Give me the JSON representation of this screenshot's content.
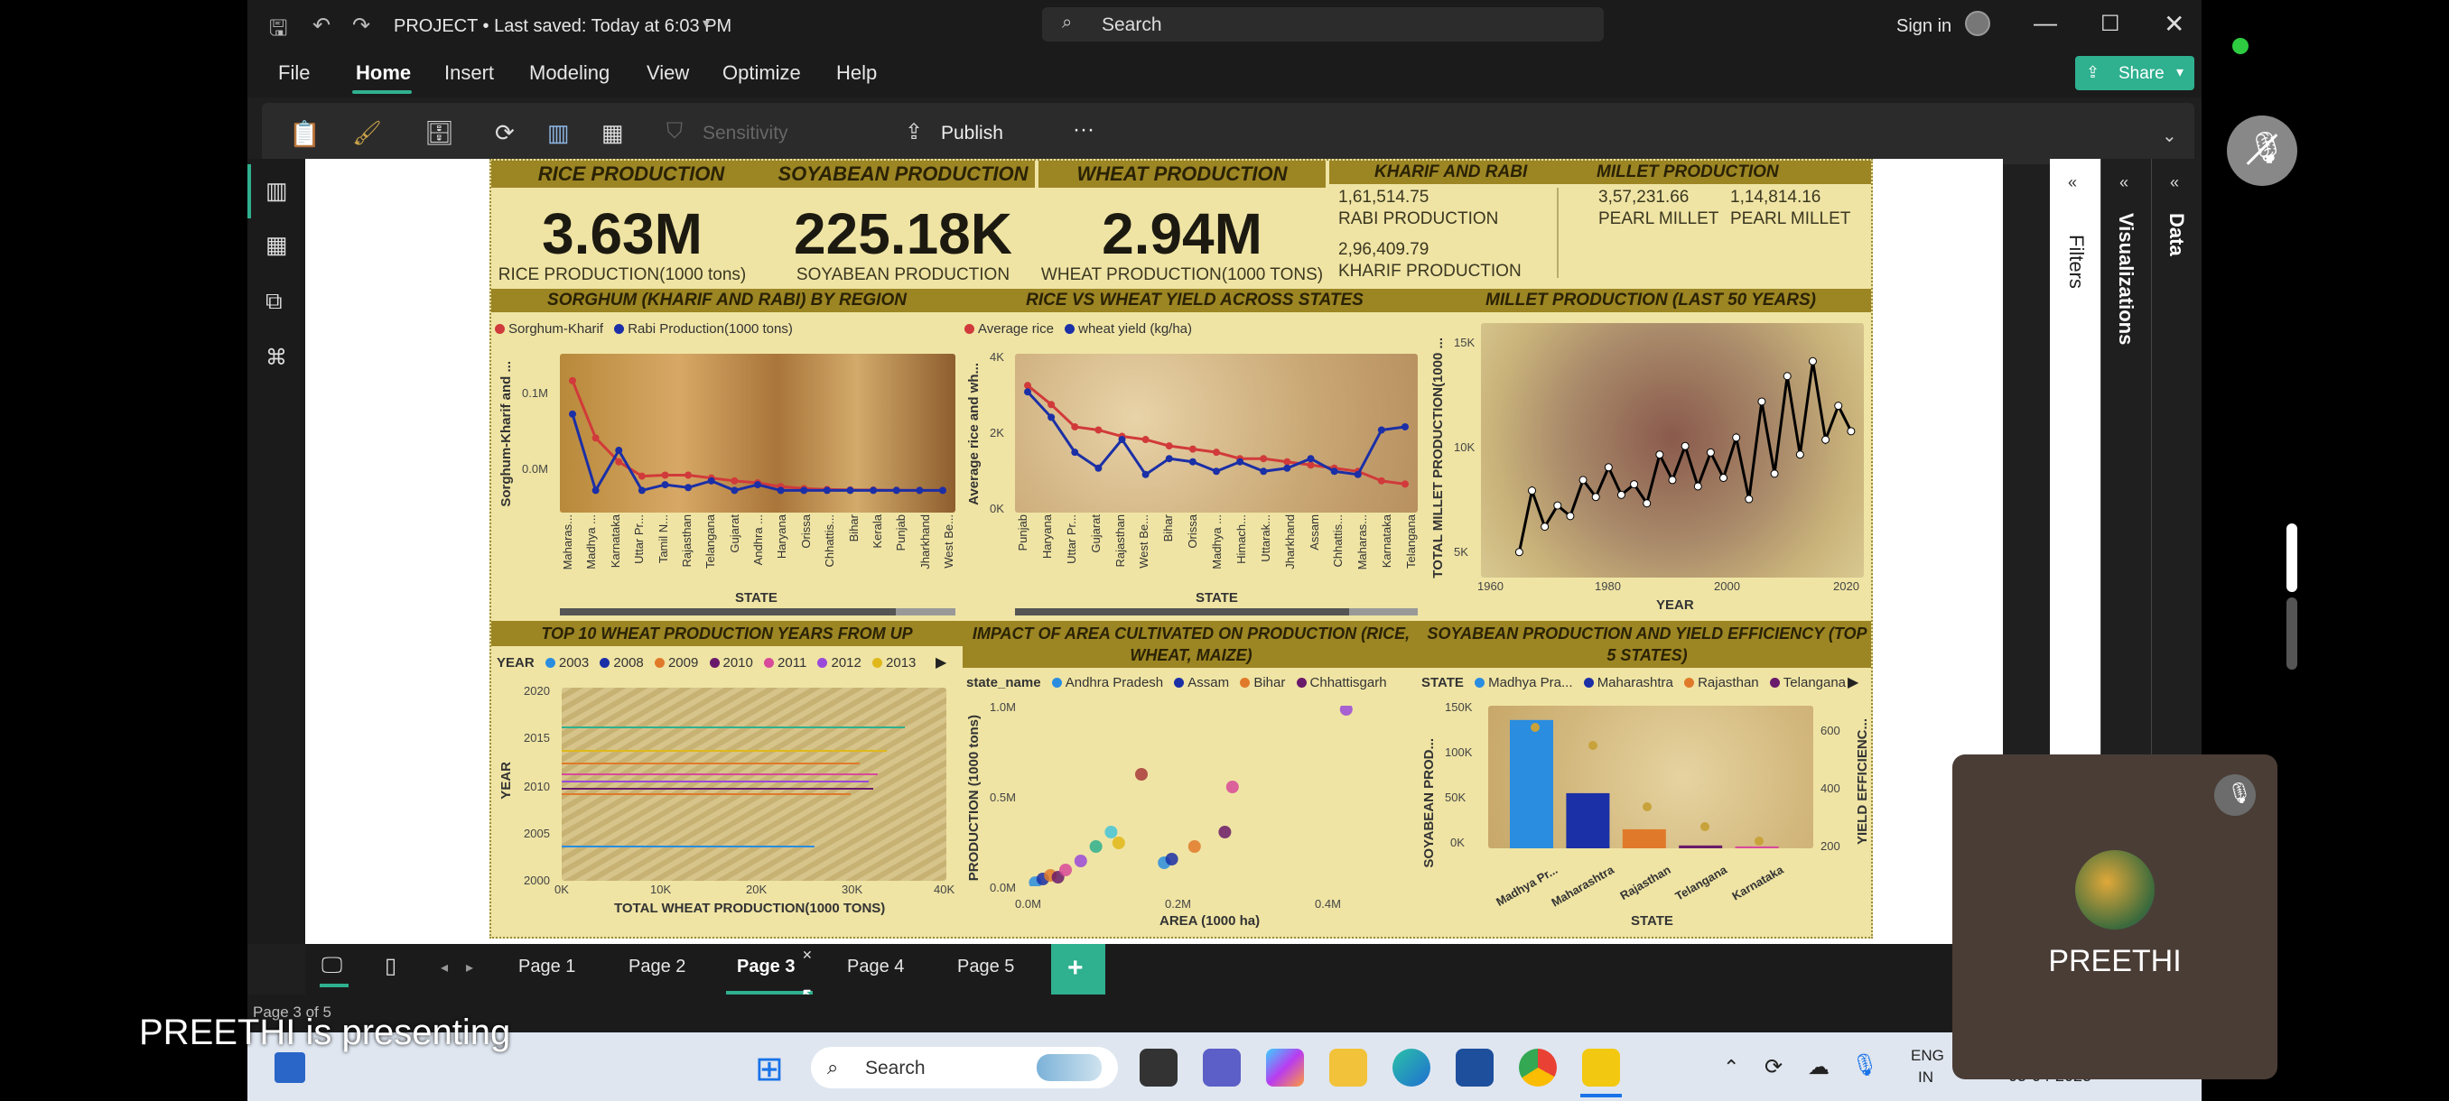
{
  "titlebar": {
    "project_title": "PROJECT • Last saved: Today at 6:03 PM",
    "search_placeholder": "Search",
    "sign_in": "Sign in"
  },
  "menu": {
    "items": [
      "File",
      "Home",
      "Insert",
      "Modeling",
      "View",
      "Optimize",
      "Help"
    ],
    "active": "Home",
    "share": "Share"
  },
  "ribbon": {
    "sensitivity": "Sensitivity",
    "publish": "Publish",
    "more": "···"
  },
  "panes": {
    "filters": "Filters",
    "visualizations": "Visualizations",
    "data": "Data"
  },
  "report": {
    "headers": {
      "rice": "RICE PRODUCTION",
      "soy": "SOYABEAN PRODUCTION",
      "wheat": "WHEAT PRODUCTION",
      "kharif_rabi": "KHARIF AND RABI",
      "millet": "MILLET PRODUCTION"
    },
    "kpis": {
      "rice_value": "3.63M",
      "rice_label": "RICE PRODUCTION(1000 tons)",
      "soy_value": "225.18K",
      "soy_label": "SOYABEAN PRODUCTION",
      "wheat_value": "2.94M",
      "wheat_label": "WHEAT PRODUCTION(1000 TONS)"
    },
    "kharif_rabi": {
      "rabi_value": "1,61,514.75",
      "rabi_label": "RABI PRODUCTION",
      "kharif_value": "2,96,409.79",
      "kharif_label": "KHARIF PRODUCTION"
    },
    "millet": {
      "v1": "3,57,231.66",
      "l1": "PEARL MILLET",
      "v2": "1,14,814.16",
      "l2": "PEARL MILLET"
    },
    "sorghum": {
      "title": "SORGHUM (KHARIF AND RABI) BY REGION",
      "legend": [
        "Sorghum-Kharif",
        "Rabi Production(1000 tons)"
      ],
      "ylabel": "Sorghum-Kharif and ...",
      "xlabel": "STATE",
      "yticks": [
        "0.1M",
        "0.0M"
      ],
      "states": [
        "Maharas...",
        "Madhya ...",
        "Karnataka",
        "Uttar Pr...",
        "Tamil N...",
        "Rajasthan",
        "Telangana",
        "Gujarat",
        "Andhra ...",
        "Haryana",
        "Orissa",
        "Chhattis...",
        "Bihar",
        "Kerala",
        "Punjab",
        "Jharkhand",
        "West Be..."
      ]
    },
    "ricewheat": {
      "title": "RICE VS WHEAT YIELD ACROSS STATES",
      "legend": [
        "Average rice",
        "wheat yield (kg/ha)"
      ],
      "ylabel": "Average rice and wh...",
      "xlabel": "STATE",
      "yticks": [
        "4K",
        "2K",
        "0K"
      ],
      "states": [
        "Punjab",
        "Haryana",
        "Uttar Pr...",
        "Gujarat",
        "Rajasthan",
        "West Be...",
        "Bihar",
        "Orissa",
        "Madhya ...",
        "Himach...",
        "Uttarak...",
        "Jharkhand",
        "Assam",
        "Chhattis...",
        "Maharas...",
        "Karnataka",
        "Telangana"
      ]
    },
    "millet_chart": {
      "title": "MILLET PRODUCTION (LAST 50 YEARS)",
      "ylabel": "TOTAL MILLET PRODUCTION(1000 ...",
      "xlabel": "YEAR",
      "yticks": [
        "15K",
        "10K",
        "5K"
      ],
      "xticks": [
        "1960",
        "1980",
        "2000",
        "2020"
      ]
    },
    "wheat_top": {
      "title": "TOP 10 WHEAT PRODUCTION YEARS FROM UP",
      "legend_title": "YEAR",
      "legend": [
        "2003",
        "2008",
        "2009",
        "2010",
        "2011",
        "2012",
        "2013"
      ],
      "ylabel": "YEAR",
      "xlabel": "TOTAL WHEAT PRODUCTION(1000 TONS)",
      "yticks": [
        "2020",
        "2015",
        "2010",
        "2005",
        "2000"
      ],
      "xticks": [
        "0K",
        "10K",
        "20K",
        "30K",
        "40K"
      ]
    },
    "impact": {
      "title": "IMPACT OF AREA CULTIVATED ON PRODUCTION (RICE, WHEAT, MAIZE)",
      "legend_title": "state_name",
      "legend": [
        "Andhra Pradesh",
        "Assam",
        "Bihar",
        "Chhattisgarh"
      ],
      "ylabel": "PRODUCTION (1000 tons)",
      "xlabel": "AREA (1000 ha)",
      "yticks": [
        "1.0M",
        "0.5M",
        "0.0M"
      ],
      "xticks": [
        "0.0M",
        "0.2M",
        "0.4M"
      ]
    },
    "soy_chart": {
      "title": "SOYABEAN PRODUCTION AND YIELD EFFICIENCY (TOP 5 STATES)",
      "legend_title": "STATE",
      "legend": [
        "Madhya Pra...",
        "Maharashtra",
        "Rajasthan",
        "Telangana"
      ],
      "ylabel": "SOYABEAN PROD...",
      "y2label": "YIELD EFFICIENC...",
      "xlabel": "STATE",
      "yticks": [
        "150K",
        "100K",
        "50K",
        "0K"
      ],
      "y2ticks": [
        "600",
        "400",
        "200"
      ],
      "states": [
        "Madhya Pr...",
        "Maharashtra",
        "Rajasthan",
        "Telangana",
        "Karnataka"
      ]
    }
  },
  "chart_data": [
    {
      "type": "line",
      "title": "SORGHUM (KHARIF AND RABI) BY REGION",
      "xlabel": "STATE",
      "ylabel": "Sorghum-Kharif and ...",
      "categories": [
        "Maharas...",
        "Madhya ...",
        "Karnataka",
        "Uttar Pr...",
        "Tamil N...",
        "Rajasthan",
        "Telangana",
        "Gujarat",
        "Andhra ...",
        "Haryana",
        "Orissa",
        "Chhattis...",
        "Bihar",
        "Kerala",
        "Punjab",
        "Jharkhand",
        "West Be..."
      ],
      "series": [
        {
          "name": "Sorghum-Kharif",
          "values": [
            0.115,
            0.055,
            0.03,
            0.015,
            0.016,
            0.016,
            0.013,
            0.01,
            0.008,
            0.004,
            0.002,
            0.001,
            0.0005,
            0.0004,
            0.0002,
            0.0001,
            0.0001
          ]
        },
        {
          "name": "Rabi Production(1000 tons)",
          "values": [
            0.08,
            0.0,
            0.042,
            0.0,
            0.006,
            0.003,
            0.01,
            0.0,
            0.006,
            0.0,
            0.0,
            0.0,
            0.0,
            0.0,
            0.0,
            0.0,
            0.0
          ]
        }
      ]
    },
    {
      "type": "line",
      "title": "RICE VS WHEAT YIELD ACROSS STATES",
      "xlabel": "STATE",
      "ylabel": "Average rice and wh...",
      "categories": [
        "Punjab",
        "Haryana",
        "Uttar Pr...",
        "Gujarat",
        "Rajasthan",
        "West Be...",
        "Bihar",
        "Orissa",
        "Madhya ...",
        "Himach...",
        "Uttarak...",
        "Jharkhand",
        "Assam",
        "Chhattis...",
        "Maharas...",
        "Karnataka",
        "Telangana"
      ],
      "series": [
        {
          "name": "Average rice",
          "values": [
            3.6,
            3.0,
            2.3,
            2.2,
            2.0,
            1.9,
            1.7,
            1.6,
            1.5,
            1.3,
            1.3,
            1.2,
            1.1,
            1.0,
            0.9,
            0.6,
            0.5
          ]
        },
        {
          "name": "wheat yield (kg/ha)",
          "values": [
            3.4,
            2.6,
            1.5,
            1.0,
            1.9,
            0.8,
            1.3,
            1.2,
            0.9,
            1.2,
            0.9,
            1.0,
            1.3,
            0.9,
            0.8,
            2.2,
            2.3
          ]
        }
      ]
    },
    {
      "type": "line",
      "title": "MILLET PRODUCTION (LAST 50 YEARS)",
      "xlabel": "YEAR",
      "ylabel": "TOTAL MILLET PRODUCTION(1000 ...",
      "x": [
        1966,
        1968,
        1970,
        1972,
        1974,
        1976,
        1978,
        1980,
        1982,
        1984,
        1986,
        1988,
        1990,
        1992,
        1994,
        1996,
        1998,
        2000,
        2002,
        2004,
        2006,
        2008,
        2010,
        2012,
        2014,
        2016,
        2018
      ],
      "values": [
        5200,
        8100,
        6400,
        7400,
        6900,
        8600,
        7800,
        9200,
        7900,
        8400,
        7500,
        9800,
        8600,
        10200,
        8300,
        9900,
        8700,
        10600,
        7700,
        12300,
        8900,
        13500,
        9800,
        14200,
        10500,
        12100,
        10900
      ],
      "ylim": [
        4000,
        16000
      ]
    },
    {
      "type": "scatter",
      "title": "IMPACT OF AREA CULTIVATED ON PRODUCTION (RICE, WHEAT, MAIZE)",
      "xlabel": "AREA (1000 ha)",
      "ylabel": "PRODUCTION (1000 tons)",
      "x": [
        0.01,
        0.02,
        0.03,
        0.04,
        0.05,
        0.07,
        0.09,
        0.11,
        0.12,
        0.15,
        0.18,
        0.19,
        0.22,
        0.26,
        0.27,
        0.42
      ],
      "values": [
        0.02,
        0.04,
        0.06,
        0.05,
        0.09,
        0.14,
        0.22,
        0.3,
        0.24,
        0.62,
        0.13,
        0.15,
        0.22,
        0.3,
        0.55,
        0.98
      ],
      "xlim": [
        0,
        0.5
      ],
      "ylim": [
        0,
        1.0
      ]
    },
    {
      "type": "bar",
      "title": "SOYABEAN PRODUCTION AND YIELD EFFICIENCY (TOP 5 STATES)",
      "xlabel": "STATE",
      "ylabel": "SOYABEAN PROD...",
      "categories": [
        "Madhya Pr...",
        "Maharashtra",
        "Rajasthan",
        "Telangana",
        "Karnataka"
      ],
      "values": [
        135000,
        58000,
        20000,
        3000,
        2000
      ],
      "ylim": [
        0,
        150000
      ]
    }
  ],
  "tabs": {
    "items": [
      "Page 1",
      "Page 2",
      "Page 3",
      "Page 4",
      "Page 5"
    ],
    "active": "Page 3",
    "status": "Page 3 of 5"
  },
  "overlay": {
    "presenting": "PREETHI is presenting",
    "presenter_name": "PREETHI"
  },
  "taskbar": {
    "search_placeholder": "Search",
    "lang1": "ENG",
    "lang2": "IN",
    "date": "05-04-2025"
  },
  "colors": {
    "accent": "#2fb08f",
    "report_bg": "#efe4a4",
    "header_bg": "#9c8523",
    "red_series": "#d13a3a",
    "blue_series": "#1b2fa6"
  }
}
